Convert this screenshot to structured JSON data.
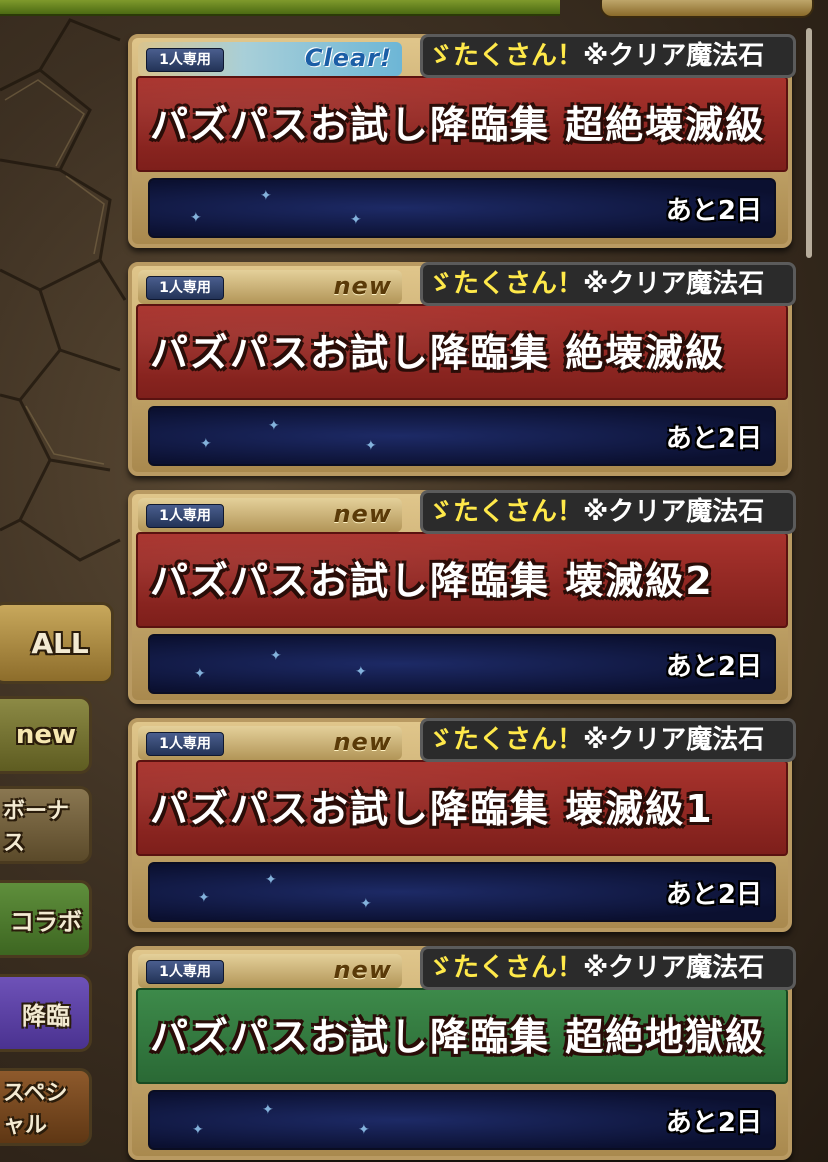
{
  "sidebar": {
    "tabs": [
      {
        "label": "ALL"
      },
      {
        "label": "new"
      },
      {
        "label": "ボーナス"
      },
      {
        "label": "コラボ"
      },
      {
        "label": "降臨"
      },
      {
        "label": "スペシャル"
      }
    ]
  },
  "quests": [
    {
      "tag": "1人専用",
      "status": "Clear!",
      "title": "パズパスお試し降臨集 超絶壊滅級",
      "ticker_a": "ゞたくさん！",
      "ticker_b": "※クリア魔法石",
      "remaining": "あと2日",
      "color": "red"
    },
    {
      "tag": "1人専用",
      "status": "new",
      "title": "パズパスお試し降臨集 絶壊滅級",
      "ticker_a": "ゞたくさん！",
      "ticker_b": "※クリア魔法石",
      "remaining": "あと2日",
      "color": "red"
    },
    {
      "tag": "1人専用",
      "status": "new",
      "title": "パズパスお試し降臨集 壊滅級2",
      "ticker_a": "ゞたくさん！",
      "ticker_b": "※クリア魔法石",
      "remaining": "あと2日",
      "color": "red"
    },
    {
      "tag": "1人専用",
      "status": "new",
      "title": "パズパスお試し降臨集 壊滅級1",
      "ticker_a": "ゞたくさん！",
      "ticker_b": "※クリア魔法石",
      "remaining": "あと2日",
      "color": "red"
    },
    {
      "tag": "1人専用",
      "status": "new",
      "title": "パズパスお試し降臨集 超絶地獄級",
      "ticker_a": "ゞたくさん！",
      "ticker_b": "※クリア魔法石",
      "remaining": "あと2日",
      "color": "green"
    }
  ],
  "colors": {
    "banner_red": "#8f2824",
    "banner_green": "#347a40",
    "ticker_yellow": "#ffe94a"
  }
}
